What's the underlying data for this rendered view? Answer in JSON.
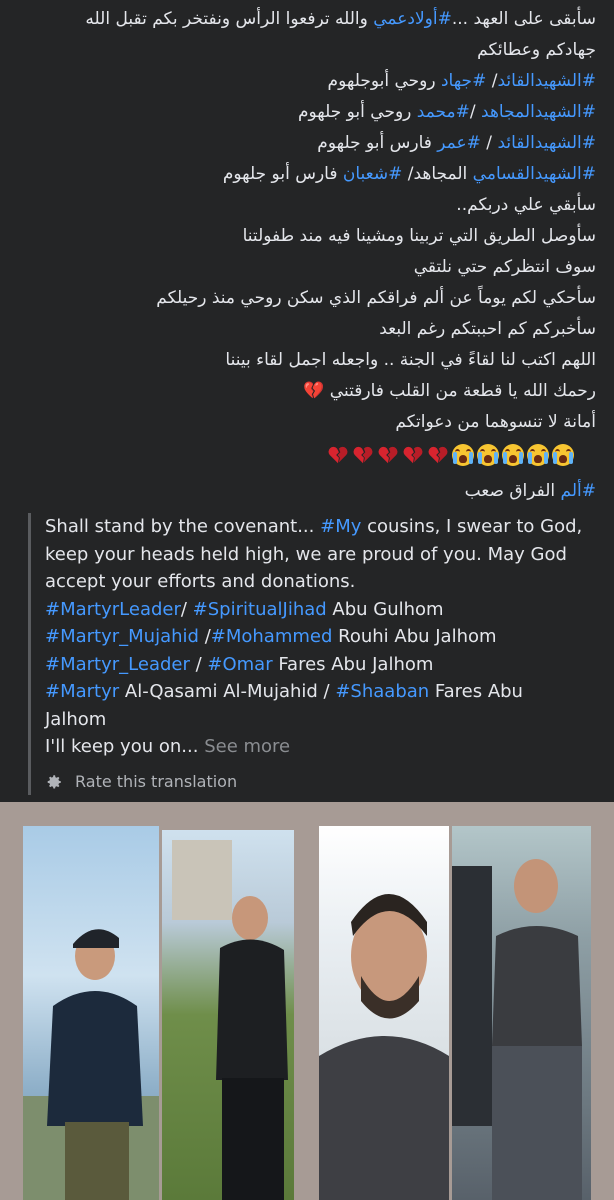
{
  "arabic_lines": [
    {
      "parts": [
        {
          "t": "سأبقى على العهد ...",
          "tag": false
        },
        {
          "t": "#أولادعمي",
          "tag": true
        },
        {
          "t": " والله ترفعوا الرأس ونفتخر بكم تقبل الله",
          "tag": false
        }
      ]
    },
    {
      "parts": [
        {
          "t": "جهادكم وعطائكم",
          "tag": false
        }
      ]
    },
    {
      "parts": [
        {
          "t": "#الشهيدالقائد",
          "tag": true
        },
        {
          "t": "/ ",
          "tag": false
        },
        {
          "t": "#جهاد",
          "tag": true
        },
        {
          "t": " روحي أبوجلهوم",
          "tag": false
        }
      ]
    },
    {
      "parts": [
        {
          "t": "#الشهيدالمجاهد",
          "tag": true
        },
        {
          "t": " /",
          "tag": false
        },
        {
          "t": "#محمد",
          "tag": true
        },
        {
          "t": " روحي أبو جلهوم",
          "tag": false
        }
      ]
    },
    {
      "parts": [
        {
          "t": "#الشهيدالقائد",
          "tag": true
        },
        {
          "t": " / ",
          "tag": false
        },
        {
          "t": "#عمر",
          "tag": true
        },
        {
          "t": " فارس أبو جلهوم",
          "tag": false
        }
      ]
    },
    {
      "parts": [
        {
          "t": "#الشهيدالقسامي",
          "tag": true
        },
        {
          "t": " المجاهد/ ",
          "tag": false
        },
        {
          "t": "#شعبان",
          "tag": true
        },
        {
          "t": " فارس أبو جلهوم",
          "tag": false
        }
      ]
    },
    {
      "parts": [
        {
          "t": "سأبقي علي دربكم..",
          "tag": false
        }
      ]
    },
    {
      "parts": [
        {
          "t": "سأوصل الطريق التي تربينا ومشينا فيه مند طفولتنا",
          "tag": false
        }
      ]
    },
    {
      "parts": [
        {
          "t": "سوف انتظركم حتي نلتقي",
          "tag": false
        }
      ]
    },
    {
      "parts": [
        {
          "t": "سأحكي لكم يوماً عن ألم فراقكم الذي سكن روحي منذ رحيلكم",
          "tag": false
        }
      ]
    },
    {
      "parts": [
        {
          "t": "سأخبركم كم احببتكم رغم البعد",
          "tag": false
        }
      ]
    },
    {
      "parts": [
        {
          "t": "اللهم اكتب لنا لقاءً في الجنة .. واجعله اجمل لقاء بيننا",
          "tag": false
        }
      ]
    },
    {
      "parts": [
        {
          "t": "رحمك الله يا قطعة من القلب فارقتني ",
          "tag": false
        },
        {
          "t": "💔",
          "tag": false
        }
      ]
    },
    {
      "parts": [
        {
          "t": "أمانة لا تنسوهما من دعواتكم",
          "tag": false
        }
      ]
    }
  ],
  "emoji_row": {
    "broken_hearts": 5,
    "crying_faces": 5
  },
  "closing_line": {
    "parts": [
      {
        "t": "#ألم",
        "tag": true
      },
      {
        "t": " الفراق صعب",
        "tag": false
      }
    ]
  },
  "translation": {
    "lines": [
      [
        {
          "t": "Shall stand by the covenant... ",
          "tag": false
        },
        {
          "t": "#My",
          "tag": true
        },
        {
          "t": " cousins, I swear to God,",
          "tag": false
        }
      ],
      [
        {
          "t": "keep your heads held high, we are proud of you. May God",
          "tag": false
        }
      ],
      [
        {
          "t": "accept your efforts and donations.",
          "tag": false
        }
      ],
      [
        {
          "t": "#MartyrLeader",
          "tag": true
        },
        {
          "t": "/ ",
          "tag": false
        },
        {
          "t": "#SpiritualJihad",
          "tag": true
        },
        {
          "t": " Abu Gulhom",
          "tag": false
        }
      ],
      [
        {
          "t": "#Martyr_Mujahid",
          "tag": true
        },
        {
          "t": " /",
          "tag": false
        },
        {
          "t": "#Mohammed",
          "tag": true
        },
        {
          "t": " Rouhi Abu Jalhom",
          "tag": false
        }
      ],
      [
        {
          "t": "#Martyr_Leader",
          "tag": true
        },
        {
          "t": " / ",
          "tag": false
        },
        {
          "t": "#Omar",
          "tag": true
        },
        {
          "t": " Fares Abu Jalhom",
          "tag": false
        }
      ],
      [
        {
          "t": "#Martyr",
          "tag": true
        },
        {
          "t": " Al-Qasami Al-Mujahid / ",
          "tag": false
        },
        {
          "t": "#Shaaban",
          "tag": true
        },
        {
          "t": " Fares Abu",
          "tag": false
        }
      ],
      [
        {
          "t": "Jalhom",
          "tag": false
        }
      ]
    ],
    "truncated_text": "I'll keep you on...",
    "see_more": "See more",
    "rate_label": "Rate this translation"
  },
  "colors": {
    "background": "#242526",
    "text": "#e4e6eb",
    "hashtag": "#4599ff",
    "muted": "#8a8d91",
    "photo_frame": "#a79b95"
  },
  "icons": {
    "rate": "gear-icon",
    "heart": "broken-heart-icon",
    "face": "loudly-crying-face-icon"
  },
  "photos": [
    {
      "name": "photo-1",
      "shirt": "#1c2a3c"
    },
    {
      "name": "photo-2",
      "shirt": "#1d1f22"
    },
    {
      "name": "photo-3",
      "shirt": "#3e3f44"
    },
    {
      "name": "photo-4",
      "shirt": "#3a3c40"
    }
  ]
}
